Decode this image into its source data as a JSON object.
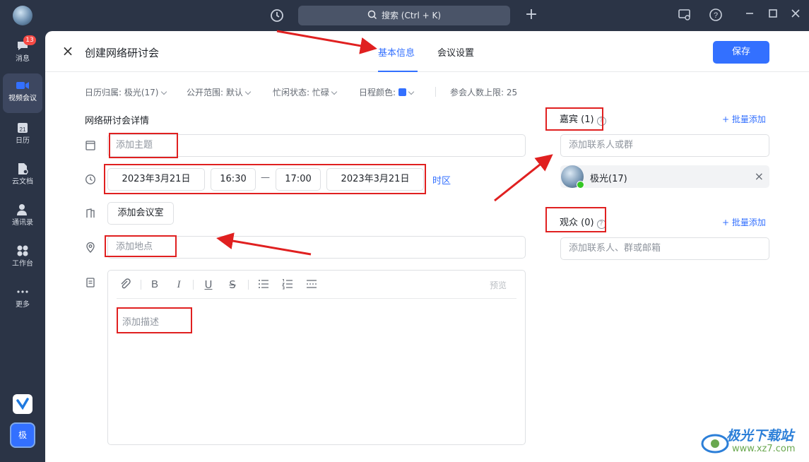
{
  "topbar": {
    "search_label": "搜索 (Ctrl + K)"
  },
  "sidebar": {
    "messages_badge": "13",
    "items": [
      {
        "label": "消息",
        "icon": "chat-bubble-icon"
      },
      {
        "label": "视频会议",
        "icon": "video-camera-icon"
      },
      {
        "label": "日历",
        "icon": "calendar-icon"
      },
      {
        "label": "云文档",
        "icon": "cloud-doc-icon"
      },
      {
        "label": "通讯录",
        "icon": "contacts-icon"
      },
      {
        "label": "工作台",
        "icon": "workspace-icon"
      },
      {
        "label": "更多",
        "icon": "more-dots-icon"
      }
    ],
    "user_initial": "极"
  },
  "header": {
    "title": "创建网络研讨会",
    "tabs": [
      "基本信息",
      "会议设置"
    ],
    "active_tab": "基本信息",
    "save_label": "保存"
  },
  "meta": {
    "calendar": "日历归属: 极光(17)",
    "visibility": "公开范围: 默认",
    "busy": "忙闲状态: 忙碌",
    "color": "日程颜色:",
    "limit": "参会人数上限: 25",
    "color_value": "#3370ff"
  },
  "details": {
    "section_title": "网络研讨会详情",
    "subject_placeholder": "添加主题",
    "start_date": "2023年3月21日",
    "start_time": "16:30",
    "dash": "—",
    "end_time": "17:00",
    "end_date": "2023年3月21日",
    "timezone": "时区",
    "room_button": "添加会议室",
    "location_placeholder": "添加地点",
    "preview": "预览",
    "description_placeholder": "添加描述"
  },
  "guests": {
    "title": "嘉宾 (1)",
    "bulk_add": "+ 批量添加",
    "search_placeholder": "添加联系人或群",
    "members": [
      {
        "name": "极光(17)"
      }
    ]
  },
  "audience": {
    "title": "观众 (0)",
    "bulk_add": "+ 批量添加",
    "search_placeholder": "添加联系人、群或邮箱"
  },
  "watermark": {
    "title": "极光下载站",
    "url": "www.xz7.com"
  }
}
